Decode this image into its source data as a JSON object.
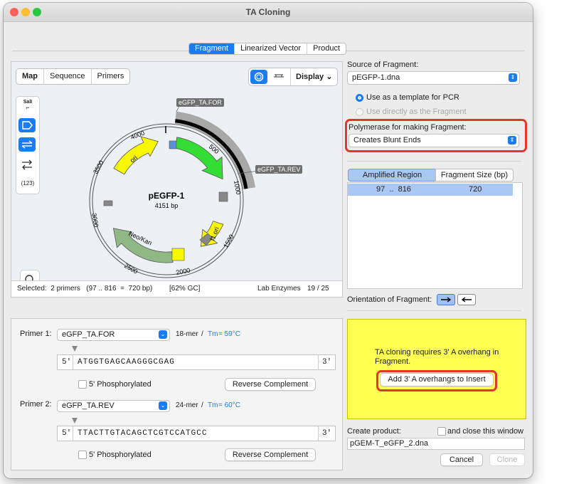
{
  "window": {
    "title": "TA Cloning"
  },
  "tabs": {
    "fragment": "Fragment",
    "linearized_vector": "Linearized Vector",
    "product": "Product"
  },
  "map_panel": {
    "view_tabs": [
      "Map",
      "Sequence",
      "Primers"
    ],
    "display_label": "Display",
    "side_tools": {
      "sall_label": "SalI",
      "number_label": "(123)"
    },
    "plasmid": {
      "name": "pEGFP-1",
      "size": "4151 bp"
    },
    "primer_labels": {
      "forward": "eGFP_TA.FOR",
      "reverse": "eGFP_TA.REV"
    },
    "features": {
      "ori": "ori",
      "egfp": "EGFP",
      "f1_ori": "f1 ori",
      "neo_kan": "Neo/Kan"
    },
    "ticks": {
      "t500": "500",
      "t1000": "1000",
      "t1500": "1500",
      "t2000": "2000",
      "t2500": "2500",
      "t3000": "3000",
      "t3500": "3500",
      "t4000": "4000"
    },
    "status": {
      "selected": "Selected:  2 primers   (97 .. 816  =  720 bp)",
      "gc": "[62% GC]",
      "enzymes_label": "Lab Enzymes",
      "enzymes_count": "19 / 25"
    }
  },
  "source": {
    "label": "Source of Fragment:",
    "value": "pEGFP-1.dna",
    "option_template": "Use as a template for PCR",
    "option_direct": "Use directly as the Fragment"
  },
  "polymerase": {
    "label": "Polymerase for making Fragment:",
    "value": "Creates Blunt Ends"
  },
  "region_table": {
    "headers": [
      "Amplified Region",
      "Fragment Size (bp)"
    ],
    "rows": [
      {
        "region": "97  ..  816",
        "size": "720"
      }
    ]
  },
  "orientation": {
    "label": "Orientation of Fragment:"
  },
  "notice": {
    "text": "TA cloning requires 3' A overhang in Fragment.",
    "button": "Add 3' A overhangs to Insert"
  },
  "primer1": {
    "label": "Primer 1:",
    "name": "eGFP_TA.FOR",
    "length": "18-mer",
    "sep": "/",
    "tm_label": "Tm",
    "tm_value": "= 59°C",
    "five_prime": "5'",
    "sequence": "ATGGTGAGCAAGGGCGAG",
    "three_prime": "3'",
    "phosphorylated": "5' Phosphorylated",
    "reverse_complement": "Reverse Complement"
  },
  "primer2": {
    "label": "Primer 2:",
    "name": "eGFP_TA.REV",
    "length": "24-mer",
    "sep": "/",
    "tm_label": "Tm",
    "tm_value": "= 60°C",
    "five_prime": "5'",
    "sequence": "TTACTTGTACAGCTCGTCCATGCC",
    "three_prime": "3'",
    "phosphorylated": "5' Phosphorylated",
    "reverse_complement": "Reverse Complement"
  },
  "product": {
    "label": "Create product:",
    "close_label": "and close this window",
    "filename": "pGEM-T_eGFP_2.dna",
    "cancel": "Cancel",
    "clone": "Clone"
  },
  "colors": {
    "accent": "#1b7cf2",
    "highlight_ring": "#e0392b",
    "notice_bg": "#ffff52",
    "egfp": "#33dd33",
    "ori": "#f7f700",
    "neo": "#90b884",
    "selection_arc": "#a8a8a8"
  }
}
